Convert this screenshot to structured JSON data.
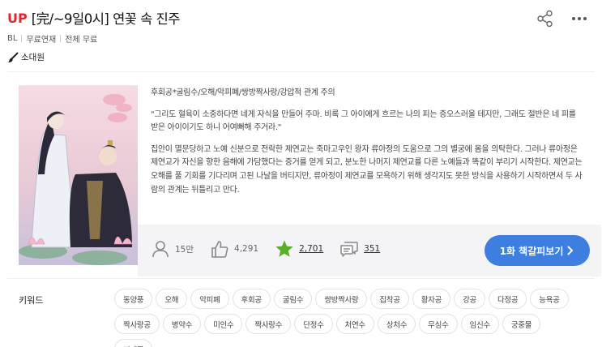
{
  "header": {
    "up_badge": "UP",
    "title": "[完/~9일0시] 연꽃 속 진주"
  },
  "meta": {
    "genre": "BL",
    "serial": "무료연재",
    "price": "전체 무료"
  },
  "author": {
    "name": "소대원"
  },
  "description": {
    "tags": "후회공*굴림수/오해/악피폐/쌍방짝사랑/강압적 관계 주의",
    "quote": "\"그리도 혈육이 소중하다면 네게 자식을 만들어 주마. 비록 그 아이에게 흐르는 나의 피는 증오스러울 테지만, 그래도 절반은 네 피를 받은 아이이기도 하니 어여뻐해 주거라.\"",
    "body": "집안이 멸문당하고 노예 신분으로 전락한 제연교는 죽마고우인 왕자 류아정의 도움으로 그의 별궁에 몸을 의탁한다. 그러나 류아정은 제연교가 자신을 향한 음해에 가담했다는 증거를 얻게 되고, 분노한 나머지 제연교를 다른 노예들과 똑같이 부리기 시작한다. 제연교는 오해를 풀 기회를 기다리며 고된 나날을 버티지만, 류아정이 제연교를 모욕하기 위해 생각지도 못한 방식을 사용하기 시작하면서 두 사람의 관계는 뒤틀리고 만다."
  },
  "stats": {
    "views": "15만",
    "likes": "4,291",
    "rating": "2,701",
    "comments": "351"
  },
  "read_button": {
    "label": "1화 책갈피보기"
  },
  "keywords": {
    "label": "키워드",
    "items": [
      "동양풍",
      "오해",
      "악피폐",
      "후회공",
      "굴림수",
      "쌍방짝사랑",
      "집착공",
      "황자공",
      "강공",
      "다정공",
      "능욕공",
      "짝사랑공",
      "병약수",
      "미인수",
      "짝사랑수",
      "단정수",
      "처연수",
      "상처수",
      "무심수",
      "임신수",
      "궁중물",
      "피폐물"
    ]
  },
  "colors": {
    "up_red": "#e5252b",
    "button_blue": "#3c7fe0",
    "star_green": "#5aad29"
  },
  "icons": [
    "share-icon",
    "more-icon",
    "brush-icon",
    "user-icon",
    "thumb-up-icon",
    "star-icon",
    "comment-icon",
    "chevron-right-icon"
  ]
}
